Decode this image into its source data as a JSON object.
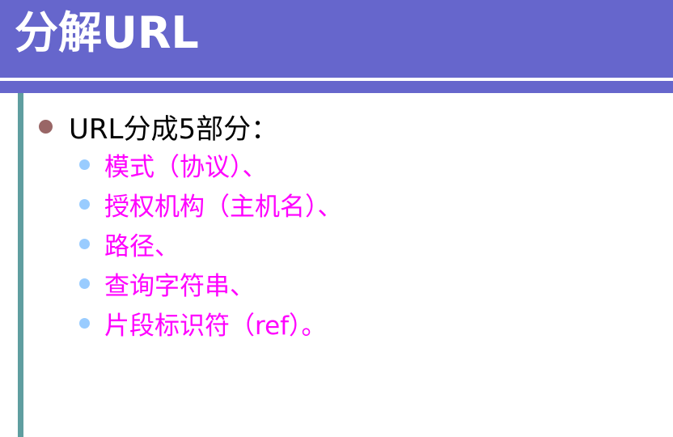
{
  "slide": {
    "title": "分解URL",
    "main_point": "URL分成5部分：",
    "sub_points": [
      "模式（协议）、",
      "授权机构（主机名）、",
      "路径、",
      "查询字符串、",
      "片段标识符（ref）。"
    ]
  },
  "colors": {
    "title_bar": "#6666cc",
    "title_text": "#ffffff",
    "side_bar": "#5f9ea0",
    "main_bullet": "#996666",
    "sub_bullet": "#99ccff",
    "sub_text": "#ff00ff"
  }
}
